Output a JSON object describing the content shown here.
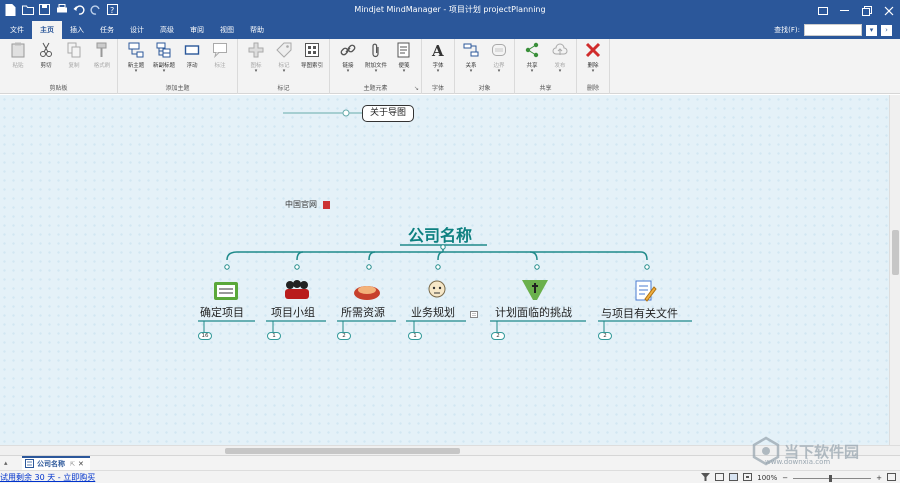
{
  "window": {
    "title": "Mindjet MindManager - 项目计划 projectPlanning"
  },
  "tabs": [
    "文件",
    "主页",
    "插入",
    "任务",
    "设计",
    "高级",
    "审阅",
    "视图",
    "帮助"
  ],
  "search": {
    "label": "查找(F):"
  },
  "ribbon": {
    "groups": [
      {
        "label": "剪贴板",
        "buttons": [
          "粘贴",
          "剪切",
          "复制",
          "格式刷"
        ]
      },
      {
        "label": "添加主题",
        "buttons": [
          "新主题",
          "新副标题",
          "浮动",
          "标注"
        ]
      },
      {
        "label": "标记",
        "buttons": [
          "图标",
          "标记",
          "导图索引"
        ]
      },
      {
        "label": "主题元素",
        "buttons": [
          "链接",
          "附加文件",
          "便笺"
        ]
      },
      {
        "label": "字体",
        "buttons": [
          "字体"
        ]
      },
      {
        "label": "对象",
        "buttons": [
          "关系",
          "边界"
        ]
      },
      {
        "label": "共享",
        "buttons": [
          "共享",
          "发布"
        ]
      },
      {
        "label": "删除",
        "buttons": [
          "删除"
        ]
      }
    ]
  },
  "map": {
    "central": "公司名称",
    "floating_label": "中国官网",
    "about_box": "关于导图",
    "topics": [
      {
        "label": "确定项目",
        "badge": "16"
      },
      {
        "label": "项目小组",
        "badge": "1"
      },
      {
        "label": "所需资源",
        "badge": "2"
      },
      {
        "label": "业务规划",
        "badge": "1"
      },
      {
        "label": "计划面临的挑战",
        "badge": "2"
      },
      {
        "label": "与项目有关文件",
        "badge": "2"
      }
    ]
  },
  "doc_tab": {
    "label": "公司名称"
  },
  "status": {
    "trial": "试用剩余 30 天 - 立即购买",
    "zoom": "100%"
  },
  "watermark": {
    "text": "当下软件园",
    "url": "www.downxia.com"
  }
}
